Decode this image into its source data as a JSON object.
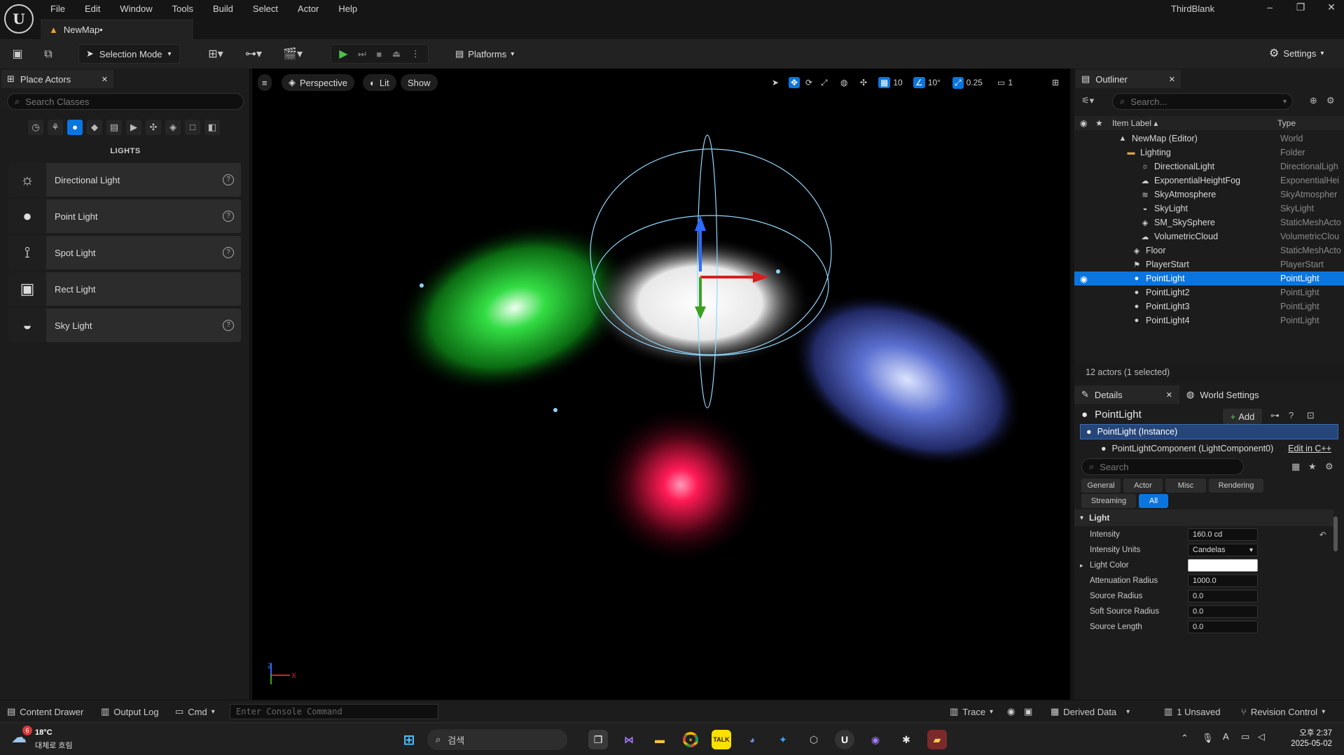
{
  "app": {
    "title": "ThirdBlank",
    "map_tab": "NewMap•"
  },
  "menu": [
    "File",
    "Edit",
    "Window",
    "Tools",
    "Build",
    "Select",
    "Actor",
    "Help"
  ],
  "toolbar": {
    "selection_mode": "Selection Mode",
    "platforms": "Platforms",
    "settings": "Settings"
  },
  "place_actors": {
    "tab": "Place Actors",
    "search_placeholder": "Search Classes",
    "category": "LIGHTS",
    "items": [
      "Directional Light",
      "Point Light",
      "Spot Light",
      "Rect Light",
      "Sky Light"
    ]
  },
  "viewport": {
    "perspective": "Perspective",
    "lit": "Lit",
    "show": "Show",
    "grid_snap": "10",
    "rot_snap": "10°",
    "scale_snap": "0.25",
    "camera_speed": "1",
    "axis_z": "Z",
    "axis_x": "X"
  },
  "outliner": {
    "tab": "Outliner",
    "search_placeholder": "Search...",
    "col_label": "Item Label ▴",
    "col_type": "Type",
    "rows": [
      {
        "label": "NewMap (Editor)",
        "type": "World"
      },
      {
        "label": "Lighting",
        "type": "Folder"
      },
      {
        "label": "DirectionalLight",
        "type": "DirectionalLigh"
      },
      {
        "label": "ExponentialHeightFog",
        "type": "ExponentialHei"
      },
      {
        "label": "SkyAtmosphere",
        "type": "SkyAtmospher"
      },
      {
        "label": "SkyLight",
        "type": "SkyLight"
      },
      {
        "label": "SM_SkySphere",
        "type": "StaticMeshActo"
      },
      {
        "label": "VolumetricCloud",
        "type": "VolumetricClou"
      },
      {
        "label": "Floor",
        "type": "StaticMeshActo"
      },
      {
        "label": "PlayerStart",
        "type": "PlayerStart"
      },
      {
        "label": "PointLight",
        "type": "PointLight"
      },
      {
        "label": "PointLight2",
        "type": "PointLight"
      },
      {
        "label": "PointLight3",
        "type": "PointLight"
      },
      {
        "label": "PointLight4",
        "type": "PointLight"
      }
    ],
    "footer": "12 actors (1 selected)"
  },
  "details": {
    "tab": "Details",
    "world_settings_tab": "World Settings",
    "actor_name": "PointLight",
    "add": "Add",
    "instance": "PointLight (Instance)",
    "component": "PointLightComponent (LightComponent0)",
    "edit_cpp": "Edit in C++",
    "search_placeholder": "Search",
    "filters": [
      "General",
      "Actor",
      "Misc",
      "Rendering",
      "Streaming",
      "All"
    ],
    "section": "Light",
    "props": [
      {
        "name": "Intensity",
        "value": "160.0 cd"
      },
      {
        "name": "Intensity Units",
        "value": "Candelas"
      },
      {
        "name": "Light Color",
        "value": ""
      },
      {
        "name": "Attenuation Radius",
        "value": "1000.0"
      },
      {
        "name": "Source Radius",
        "value": "0.0"
      },
      {
        "name": "Soft Source Radius",
        "value": "0.0"
      },
      {
        "name": "Source Length",
        "value": "0.0"
      }
    ]
  },
  "bottombar": {
    "content_drawer": "Content Drawer",
    "output_log": "Output Log",
    "cmd": "Cmd",
    "console_placeholder": "Enter Console Command",
    "trace": "Trace",
    "derived_data": "Derived Data",
    "unsaved": "1 Unsaved",
    "revision_control": "Revision Control"
  },
  "taskbar": {
    "weather_badge": "6",
    "temperature": "18°C",
    "weather_text": "대체로 흐림",
    "search": "검색",
    "time": "오후 2:37",
    "date": "2025-05-02"
  },
  "colors": {
    "accent": "#0b75df",
    "selection": "#0b75df"
  }
}
